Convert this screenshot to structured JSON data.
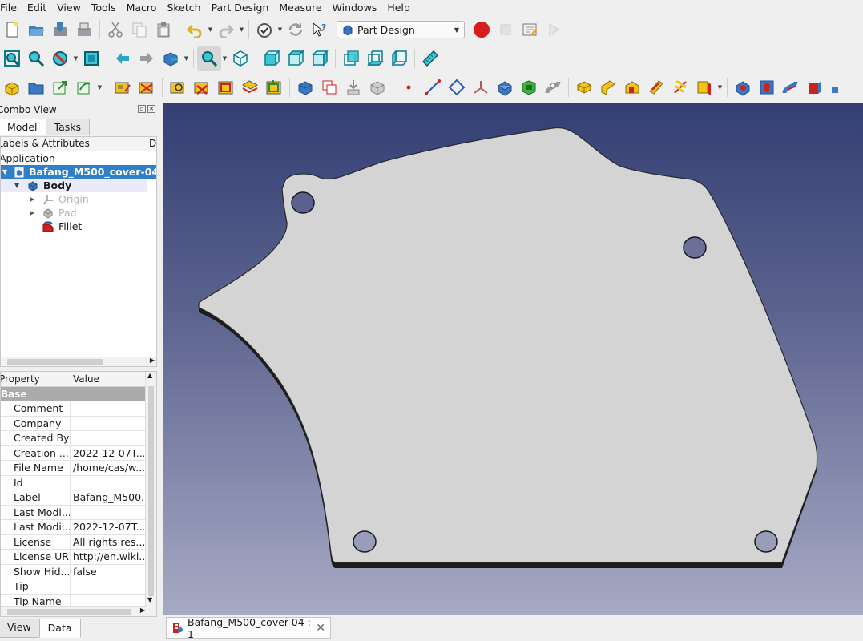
{
  "menubar": [
    "File",
    "Edit",
    "View",
    "Tools",
    "Macro",
    "Sketch",
    "Part Design",
    "Measure",
    "Windows",
    "Help"
  ],
  "toolbar1": {
    "workbench": "Part Design",
    "icons": [
      "new-file-icon",
      "open-file-icon",
      "save-icon",
      "save-as-icon",
      "cut-icon",
      "copy-icon",
      "paste-icon",
      "undo-icon",
      "redo-icon",
      "refresh-check-icon",
      "recompute-icon",
      "whats-this-icon",
      "record-macro-icon",
      "stop-macro-icon",
      "macro-editor-icon",
      "run-macro-icon"
    ]
  },
  "combo": {
    "title": "Combo View",
    "tabs": [
      "Model",
      "Tasks"
    ],
    "tree": {
      "col1": "Labels & Attributes",
      "col2": "De",
      "root": "Application",
      "document": "Bafang_M500_cover-04",
      "body": "Body",
      "origin": "Origin",
      "pad": "Pad",
      "fillet": "Fillet"
    },
    "props": {
      "col1": "Property",
      "col2": "Value",
      "group": "Base",
      "rows": [
        {
          "name": "Comment",
          "value": ""
        },
        {
          "name": "Company",
          "value": ""
        },
        {
          "name": "Created By",
          "value": ""
        },
        {
          "name": "Creation ...",
          "value": "2022-12-07T..."
        },
        {
          "name": "File Name",
          "value": "/home/cas/w..."
        },
        {
          "name": "Id",
          "value": ""
        },
        {
          "name": "Label",
          "value": "Bafang_M500..."
        },
        {
          "name": "Last Modi...",
          "value": ""
        },
        {
          "name": "Last Modi...",
          "value": "2022-12-07T..."
        },
        {
          "name": "License",
          "value": "All rights res..."
        },
        {
          "name": "License URL",
          "value": "http://en.wiki..."
        },
        {
          "name": "Show Hid...",
          "value": "false"
        },
        {
          "name": "Tip",
          "value": ""
        },
        {
          "name": "Tip Name",
          "value": ""
        }
      ]
    },
    "view_tabs": [
      "View",
      "Data"
    ]
  },
  "document_tab": "Bafang_M500_cover-04 : 1",
  "colors": {
    "selection": "#2f80c8",
    "viewport_top": "#333e73",
    "viewport_bottom": "#a7aac3",
    "part_face": "#d4d4d4",
    "record": "#d41e1e"
  }
}
